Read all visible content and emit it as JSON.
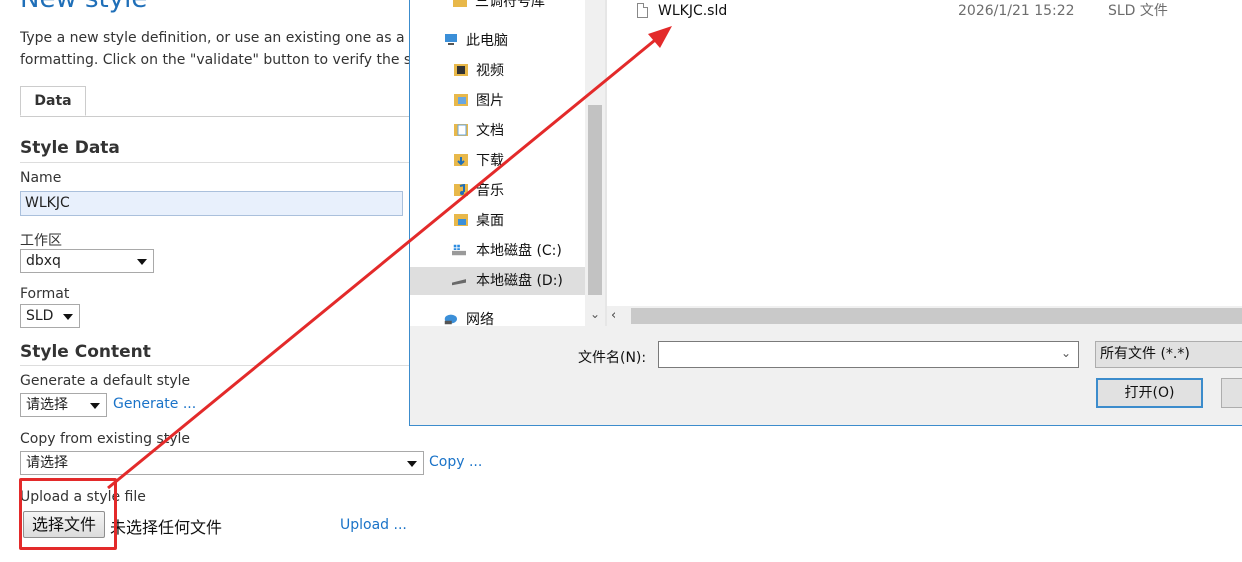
{
  "page": {
    "title": "New style",
    "description_line1": "Type a new style definition, or use an existing one as a tem",
    "description_line2": "formatting. Click on the \"validate\" button to verify the style"
  },
  "tabs": [
    {
      "label": "Data",
      "active": true
    }
  ],
  "style_data": {
    "heading": "Style Data",
    "name_label": "Name",
    "name_value": "WLKJC",
    "workspace_label": "工作区",
    "workspace_value": "dbxq",
    "format_label": "Format",
    "format_value": "SLD"
  },
  "style_content": {
    "heading": "Style Content",
    "generate_label": "Generate a default style",
    "generate_select": "请选择",
    "generate_link": "Generate ...",
    "copy_label": "Copy from existing style",
    "copy_select": "请选择",
    "copy_link": "Copy ...",
    "upload_label": "Upload a style file",
    "choose_file_button": "选择文件",
    "no_file_text": "未选择任何文件",
    "upload_link": "Upload ..."
  },
  "dialog": {
    "nav_items": [
      {
        "label": "三调符号库",
        "icon": "folder-icon"
      },
      {
        "label": "此电脑",
        "icon": "computer-icon"
      },
      {
        "label": "视频",
        "icon": "video-folder-icon"
      },
      {
        "label": "图片",
        "icon": "pictures-folder-icon"
      },
      {
        "label": "文档",
        "icon": "documents-folder-icon"
      },
      {
        "label": "下载",
        "icon": "downloads-folder-icon"
      },
      {
        "label": "音乐",
        "icon": "music-folder-icon"
      },
      {
        "label": "桌面",
        "icon": "desktop-folder-icon"
      },
      {
        "label": "本地磁盘 (C:)",
        "icon": "windows-drive-icon"
      },
      {
        "label": "本地磁盘 (D:)",
        "icon": "drive-icon",
        "selected": true
      },
      {
        "label": "网络",
        "icon": "network-icon"
      }
    ],
    "files": [
      {
        "name": "WLKJC.sld",
        "modified": "2026/1/21 15:22",
        "type": "SLD 文件"
      }
    ],
    "filename_label": "文件名(N):",
    "filename_value": "",
    "filetype_value": "所有文件 (*.*)",
    "open_button": "打开(O)"
  },
  "colors": {
    "title_blue": "#1f6fb8",
    "link_blue": "#1a73c8",
    "annotation_red": "#e32a2a",
    "dialog_border": "#3c8ccc"
  }
}
